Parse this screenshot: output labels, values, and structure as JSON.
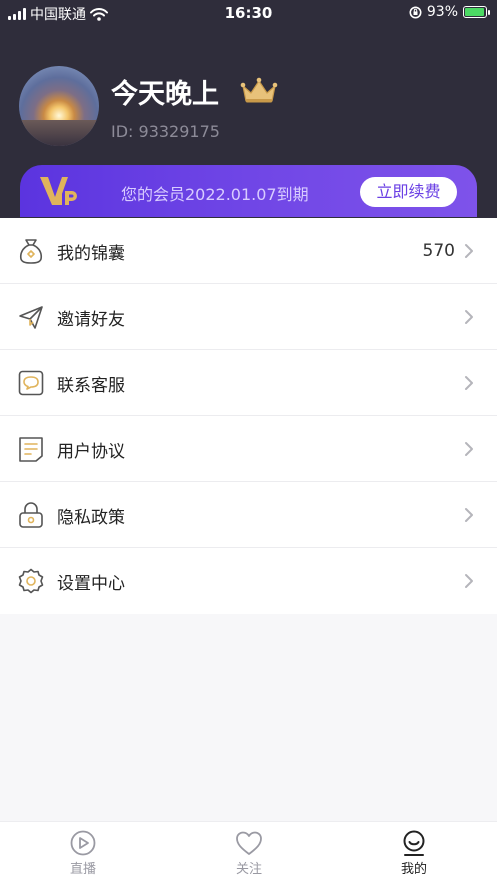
{
  "status_bar": {
    "carrier": "中国联通",
    "time": "16:30",
    "battery": "93%",
    "battery_level": 0.93
  },
  "profile": {
    "name": "今天晚上",
    "id_text": "ID: 93329175",
    "badge_icon": "crown-icon"
  },
  "vip": {
    "logo_text": "VIP",
    "expiry_text": "您的会员2022.01.07到期",
    "renew_label": "立即续费",
    "colors": {
      "gradient_start": "#5b34df",
      "gradient_end": "#7e53ea",
      "gold": "#e0b45c"
    }
  },
  "menu": {
    "items": [
      {
        "label": "我的锦囊",
        "value": "570",
        "icon": "pouch-icon"
      },
      {
        "label": "邀请好友",
        "value": "",
        "icon": "paper-plane-icon"
      },
      {
        "label": "联系客服",
        "value": "",
        "icon": "chat-bubble-icon"
      },
      {
        "label": "用户协议",
        "value": "",
        "icon": "document-icon"
      },
      {
        "label": "隐私政策",
        "value": "",
        "icon": "lock-icon"
      },
      {
        "label": "设置中心",
        "value": "",
        "icon": "gear-icon"
      }
    ]
  },
  "tabbar": {
    "tabs": [
      {
        "label": "直播",
        "icon": "play-icon",
        "active": false
      },
      {
        "label": "关注",
        "icon": "heart-icon",
        "active": false
      },
      {
        "label": "我的",
        "icon": "profile-face-icon",
        "active": true
      }
    ]
  }
}
